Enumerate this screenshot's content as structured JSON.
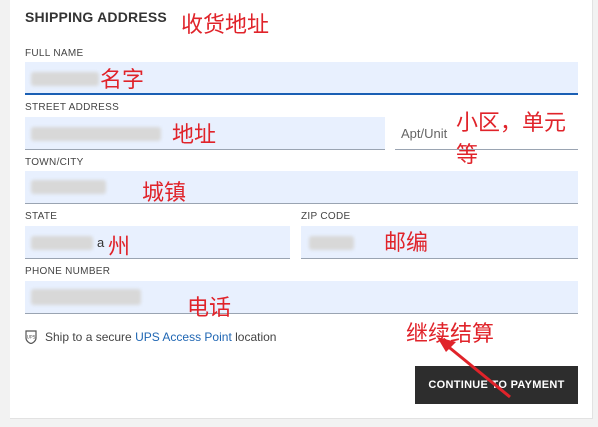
{
  "form": {
    "title": "SHIPPING ADDRESS",
    "fields": {
      "full_name": {
        "label": "FULL NAME"
      },
      "street": {
        "label": "STREET ADDRESS"
      },
      "apt": {
        "placeholder": "Apt/Unit"
      },
      "town": {
        "label": "TOWN/CITY"
      },
      "state": {
        "label": "STATE",
        "value_suffix": "a"
      },
      "zip": {
        "label": "ZIP CODE"
      },
      "phone": {
        "label": "PHONE NUMBER"
      }
    },
    "ups": {
      "prefix": "Ship to a secure ",
      "link": "UPS Access Point",
      "suffix": " location",
      "icon": "ups-shield-icon"
    },
    "continue_label": "CONTINUE TO PAYMENT"
  },
  "annotations": {
    "title": "收货地址",
    "name": "名字",
    "street": "地址",
    "apt_line1": "小区，单元",
    "apt_line2": "等",
    "town": "城镇",
    "state": "州",
    "zip": "邮编",
    "phone": "电话",
    "continue": "继续结算"
  },
  "colors": {
    "annotation": "#e0232a",
    "field_bg": "#e8f0fe",
    "link": "#1f66b3",
    "button_bg": "#2d2d2d"
  }
}
